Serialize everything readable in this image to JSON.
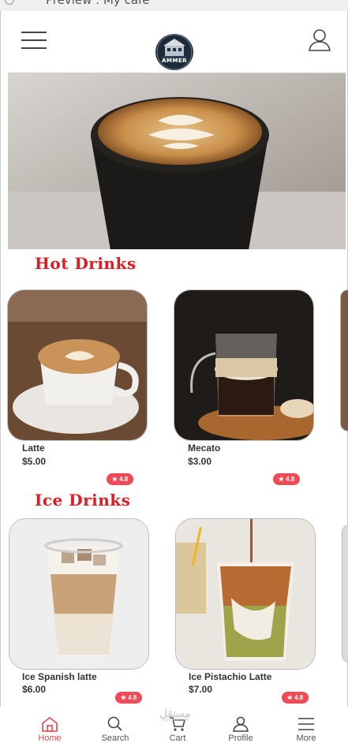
{
  "window": {
    "title": "Preview : My cafe"
  },
  "header": {
    "logo_text": "AMMER"
  },
  "sections": [
    {
      "title": "Hot Drinks",
      "products": [
        {
          "name": "Latte",
          "price": "$5.00",
          "rating": "★ 4.8"
        },
        {
          "name": "Mecato",
          "price": "$3.00",
          "rating": "★ 4.8"
        }
      ]
    },
    {
      "title": "Ice Drinks",
      "products": [
        {
          "name": "Ice Spanish latte",
          "price": "$6.00",
          "rating": "★ 4.8"
        },
        {
          "name": "Ice Pistachio Latte",
          "price": "$7.00",
          "rating": "★ 4.8"
        }
      ]
    }
  ],
  "bottom_nav": [
    {
      "label": "Home",
      "icon": "home-icon",
      "active": true
    },
    {
      "label": "Search",
      "icon": "search-icon",
      "active": false
    },
    {
      "label": "Cart",
      "icon": "cart-icon",
      "active": false
    },
    {
      "label": "Profile",
      "icon": "profile-icon",
      "active": false
    },
    {
      "label": "More",
      "icon": "menu-icon",
      "active": false
    }
  ],
  "watermark": {
    "text": "مستقل",
    "subtext": "mostaql.com"
  },
  "colors": {
    "accent": "#e01b24",
    "rating_badge": "#ef4a55",
    "active_nav": "#e5484d"
  }
}
